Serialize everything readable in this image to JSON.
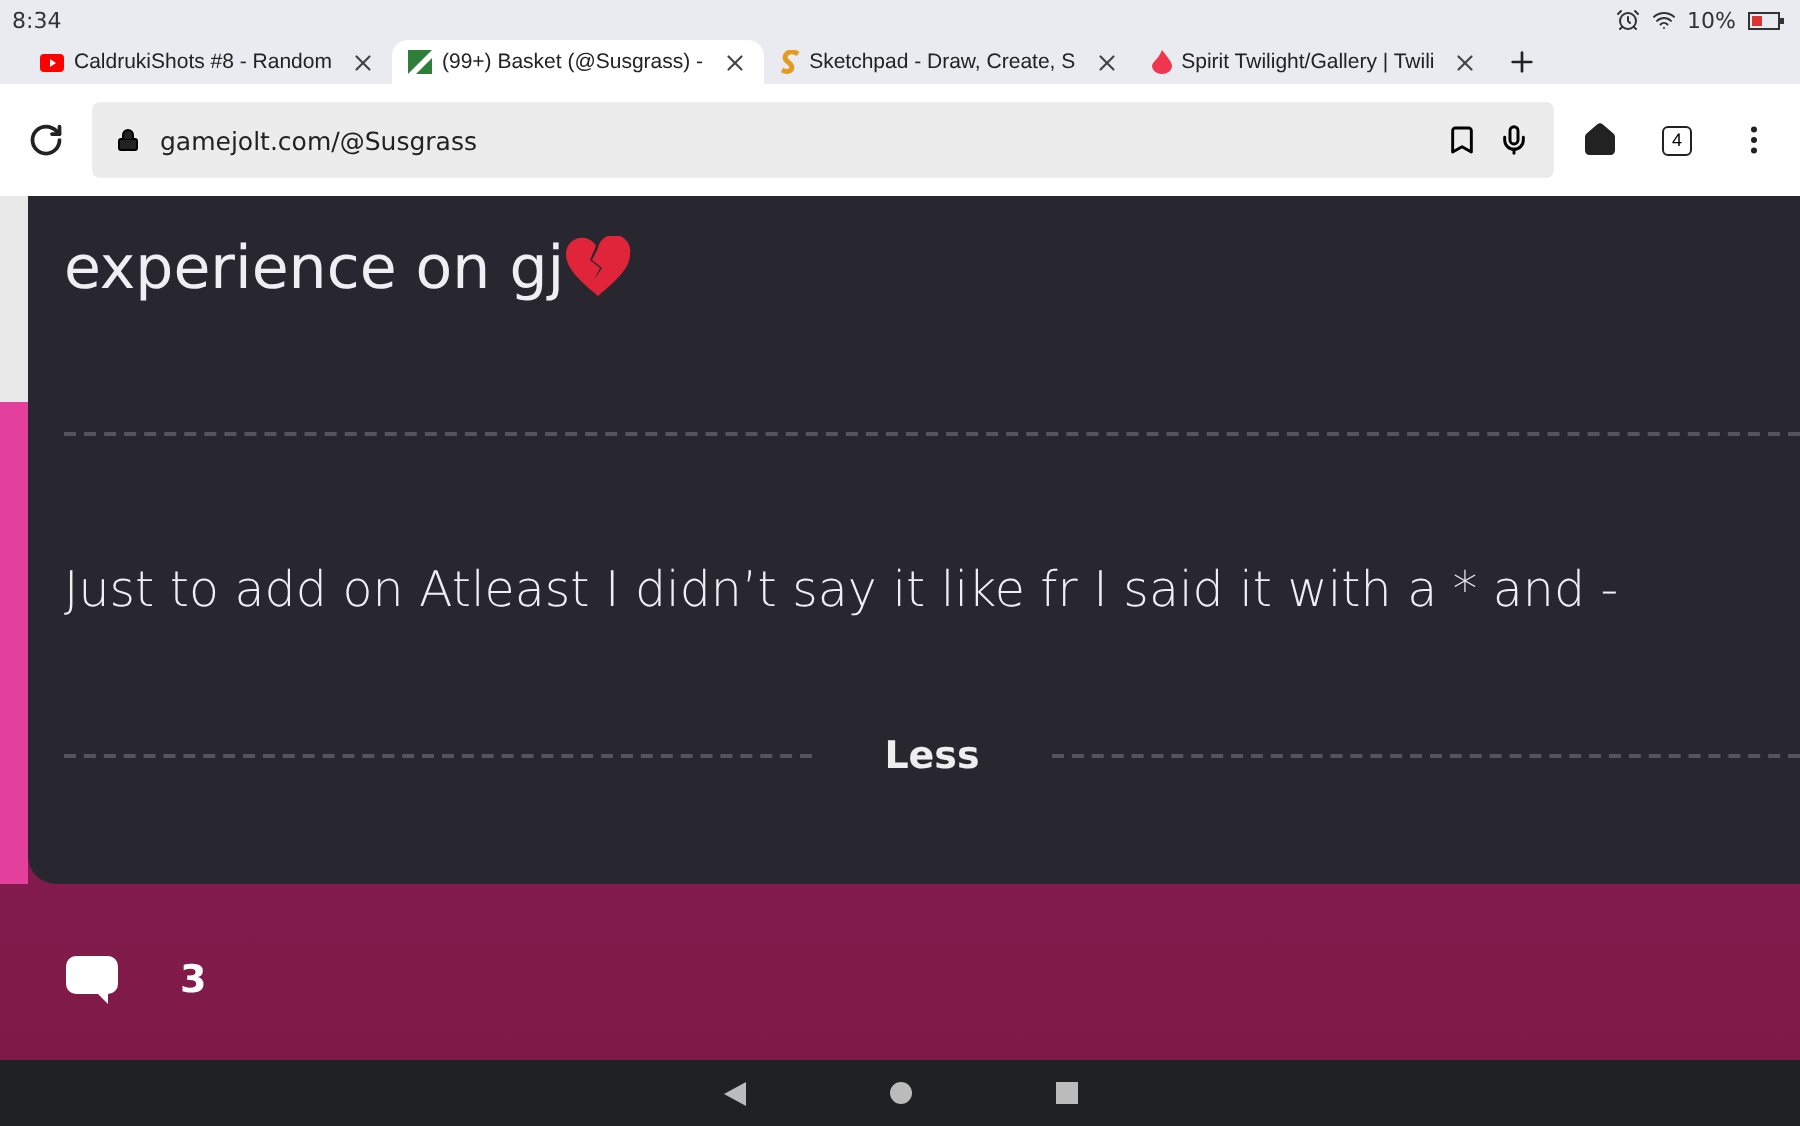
{
  "status_bar": {
    "time": "8:34",
    "battery": "10%"
  },
  "tabs": [
    {
      "title": "CaldrukiShots #8 - Random",
      "selected": false
    },
    {
      "title": "(99+) Basket (@Susgrass) -",
      "selected": true
    },
    {
      "title": "Sketchpad - Draw, Create, S",
      "selected": false
    },
    {
      "title": "Spirit Twilight/Gallery | Twili",
      "selected": false
    }
  ],
  "toolbar": {
    "url": "gamejolt.com/@Susgrass",
    "tab_count": "4"
  },
  "post": {
    "paragraphs": [
      "experience on gj",
      "Just to add on Atleast I didn’t say it like fr I said it with a * and -"
    ],
    "toggle": "Less",
    "comment_count": "3"
  }
}
